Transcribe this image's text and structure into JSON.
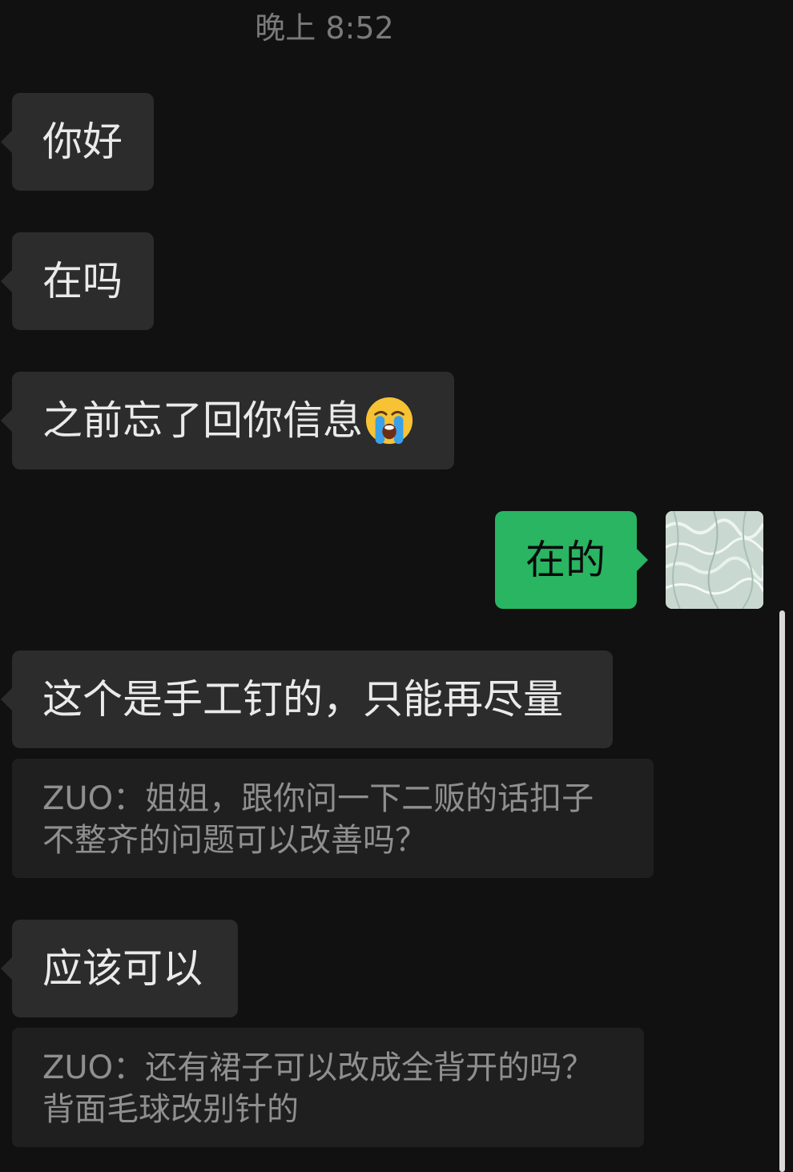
{
  "timestamp": "晚上 8:52",
  "messages": [
    {
      "text": "你好"
    },
    {
      "text": "在吗"
    },
    {
      "text": "之前忘了回你信息",
      "emoji": "loudly-crying-face"
    },
    {
      "text": "在的"
    },
    {
      "text": "这个是手工钉的，只能再尽量"
    },
    {
      "text": "应该可以"
    }
  ],
  "quotes": [
    {
      "line1": "ZUO：姐姐，跟你问一下二贩的话扣子",
      "line2": "不整齐的问题可以改善吗？"
    },
    {
      "line1": "ZUO：还有裙子可以改成全背开的吗？",
      "line2": "背面毛球改别针的"
    }
  ],
  "colors": {
    "background": "#111111",
    "incoming_bubble": "#2c2c2c",
    "outgoing_bubble": "#29b562",
    "quote_bubble": "#1f1f1f",
    "timestamp_text": "#7a7a7a"
  }
}
